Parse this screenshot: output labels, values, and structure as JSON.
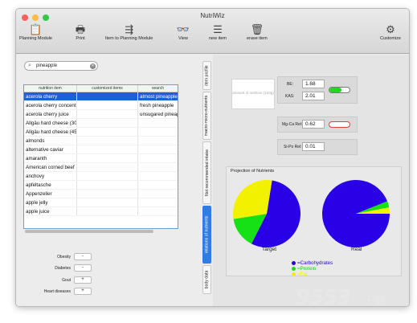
{
  "window": {
    "title": "NutriWiz",
    "lights": [
      "#fc605c",
      "#fdbc40",
      "#34c84a"
    ]
  },
  "toolbar": {
    "items": [
      {
        "label": "Planning Module",
        "icon": "planning-module-icon",
        "glyph": "📋"
      },
      {
        "label": "Print",
        "icon": "printer-icon",
        "glyph": "🖶"
      },
      {
        "label": "Item to Planning Module",
        "icon": "item-to-planning-icon",
        "glyph": "⇶"
      },
      {
        "label": "View",
        "icon": "glasses-icon",
        "glyph": "👓"
      },
      {
        "label": "new item",
        "icon": "new-item-icon",
        "glyph": "☰"
      },
      {
        "label": "erase item",
        "icon": "trash-icon",
        "glyph": "🗑"
      },
      {
        "label": "Customize",
        "icon": "gears-icon",
        "glyph": "⚙"
      }
    ]
  },
  "search": {
    "value": "pineapple"
  },
  "table": {
    "columns": [
      "nutrition item",
      "customized items",
      "search"
    ],
    "rows": [
      {
        "item": "acerola cherry",
        "custom": "",
        "search": "almost pineapple"
      },
      {
        "item": "acerola cherry concentrate",
        "custom": "",
        "search": "fresh pineapple"
      },
      {
        "item": "acerola cherry juice",
        "custom": "",
        "search": "unsugared pineapple"
      },
      {
        "item": "Allgäu hard cheese (30%)",
        "custom": "",
        "search": ""
      },
      {
        "item": "Allgäu hard cheese (45%)",
        "custom": "",
        "search": ""
      },
      {
        "item": "almonds",
        "custom": "",
        "search": ""
      },
      {
        "item": "alternative caviar",
        "custom": "",
        "search": ""
      },
      {
        "item": "amaranth",
        "custom": "",
        "search": ""
      },
      {
        "item": "American corned beef",
        "custom": "",
        "search": ""
      },
      {
        "item": "anchovy",
        "custom": "",
        "search": ""
      },
      {
        "item": "apfeltasche",
        "custom": "",
        "search": ""
      },
      {
        "item": "Appenzeller",
        "custom": "",
        "search": ""
      },
      {
        "item": "apple jelly",
        "custom": "",
        "search": ""
      },
      {
        "item": "apple juice",
        "custom": "",
        "search": ""
      }
    ],
    "selected_index": 0
  },
  "flags": [
    {
      "label": "Obesity",
      "value": "-"
    },
    {
      "label": "Diabetes",
      "value": "-"
    },
    {
      "label": "Gout",
      "value": "+"
    },
    {
      "label": "Heart diseases",
      "value": "+"
    }
  ],
  "tabs": [
    {
      "label": "item profile"
    },
    {
      "label": "macro-micro-nutrients"
    },
    {
      "label": "Not recommended intake"
    },
    {
      "label": "relations of nutrients"
    },
    {
      "label": "body data"
    }
  ],
  "active_tab": 3,
  "panel": {
    "placeholder": "amount of nutrition (100g)",
    "be_label": "BE:",
    "be_value": "1.68",
    "kas_label": "KAS:",
    "kas_value": "2.01",
    "mgca_label": "Mg-Ca Rel:",
    "mgca_value": "0.62",
    "sipo_label": "Si-Po Rel:",
    "sipo_value": "0.01",
    "kas_indicator_color": "#22d622",
    "mgca_indicator_color": "#e53b3b"
  },
  "projection": {
    "title": "Projection of Nutrients",
    "target_label": "Target",
    "real_label": "Real",
    "legend": [
      {
        "label": "=Carbohydrates",
        "color": "#2a00e6"
      },
      {
        "label": "=Protein",
        "color": "#16e016"
      },
      {
        "label": "=Fat",
        "color": "#f2f200"
      }
    ]
  },
  "chart_data": [
    {
      "type": "pie",
      "title": "Target",
      "categories": [
        "Carbohydrates",
        "Protein",
        "Fat"
      ],
      "values": [
        55,
        15,
        30
      ],
      "colors": [
        "#2a00e6",
        "#16e016",
        "#f2f200"
      ]
    },
    {
      "type": "pie",
      "title": "Real",
      "categories": [
        "Carbohydrates",
        "Protein",
        "Fat"
      ],
      "values": [
        94,
        3,
        3
      ],
      "colors": [
        "#2a00e6",
        "#16e016",
        "#f2f200"
      ]
    }
  ],
  "watermark": {
    "main": "9553",
    "sub": "下载"
  }
}
